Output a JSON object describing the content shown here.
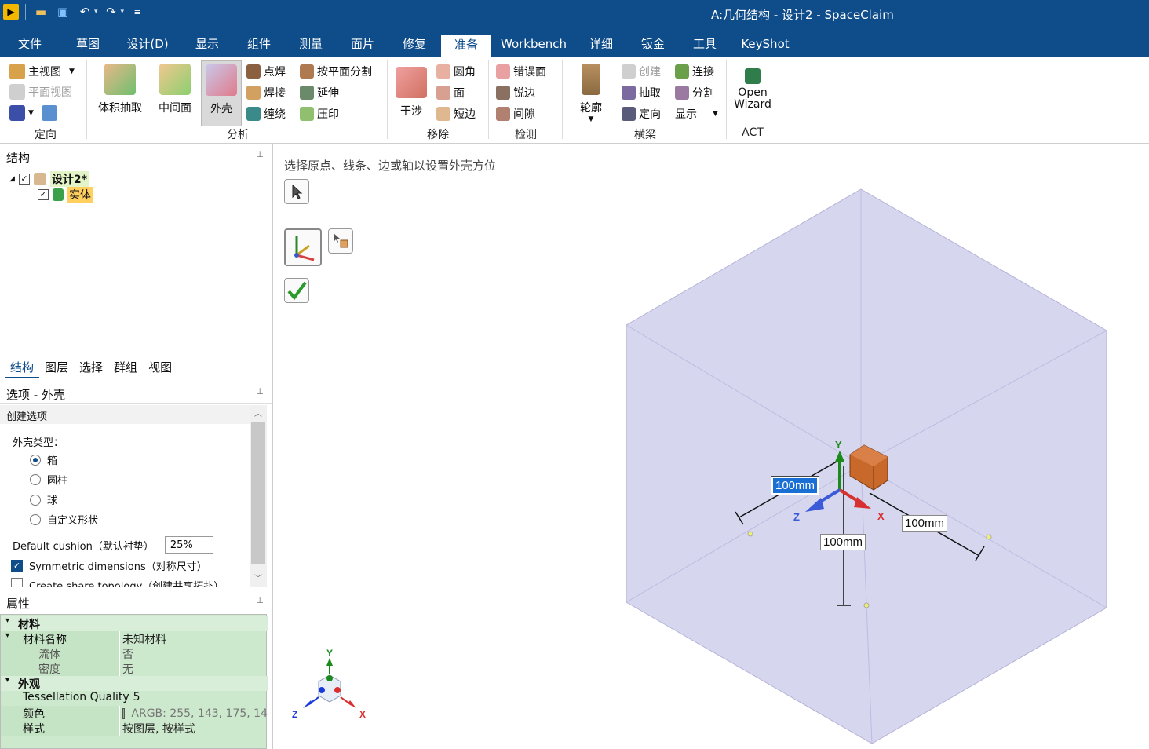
{
  "window": {
    "title": "A:几何结构 - 设计2 - SpaceClaim"
  },
  "menu": {
    "tabs": [
      "文件",
      "草图",
      "设计(D)",
      "显示",
      "组件",
      "测量",
      "面片",
      "修复",
      "准备",
      "Workbench",
      "详细",
      "钣金",
      "工具",
      "KeyShot"
    ],
    "active": "准备"
  },
  "ribbon": {
    "orient": {
      "home": "主视图",
      "plan": "平面视图",
      "label": "定向"
    },
    "analysis": {
      "volume_extract": "体积抽取",
      "mid_surface": "中间面",
      "enclosure": "外壳",
      "spot_weld": "点焊",
      "weld": "焊接",
      "wrap": "缠绕",
      "split_by_plane": "按平面分割",
      "extend": "延伸",
      "imprint": "压印",
      "label": "分析"
    },
    "remove": {
      "interference": "干涉",
      "round": "圆角",
      "face": "面",
      "short_edge": "短边",
      "label": "移除"
    },
    "detect": {
      "bad_face": "错误面",
      "sharp_edge": "锐边",
      "gap": "间隙",
      "label": "检测"
    },
    "beam": {
      "profile": "轮廓",
      "create": "创建",
      "extract": "抽取",
      "orient": "定向",
      "connect": "连接",
      "split": "分割",
      "display": "显示",
      "label": "横梁"
    },
    "act": {
      "open_wizard_1": "Open",
      "open_wizard_2": "Wizard",
      "label": "ACT"
    }
  },
  "structure": {
    "header": "结构",
    "root": "设计2*",
    "child": "实体",
    "tabs": [
      "结构",
      "图层",
      "选择",
      "群组",
      "视图"
    ]
  },
  "options": {
    "header": "选项 - 外壳",
    "section": "创建选项",
    "enclosure_type_label": "外壳类型：",
    "types": [
      "箱",
      "圆柱",
      "球",
      "自定义形状"
    ],
    "selected_type": "箱",
    "cushion_label": "Default cushion（默认衬垫）",
    "cushion_value": "25%",
    "symmetric_label": "Symmetric dimensions（对称尺寸）",
    "symmetric_checked": true,
    "share_topology_label": "Create share topology（创建共享拓扑）",
    "share_topology_checked": false
  },
  "properties": {
    "header": "属性",
    "material_cat": "材料",
    "material_name_key": "材料名称",
    "material_name_val": "未知材料",
    "fluid_key": "流体",
    "fluid_val": "否",
    "density_key": "密度",
    "density_val": "无",
    "appearance_cat": "外观",
    "tess_key": "Tessellation Quality",
    "tess_val": "5",
    "color_key": "颜色",
    "color_val": "ARGB: 255, 143, 175, 14",
    "color_swatch": "#8faf8e",
    "style_key": "样式",
    "style_val": "按图层, 按样式"
  },
  "viewport": {
    "hint": "选择原点、线条、边或轴以设置外壳方位",
    "dim_selected": "100mm",
    "dim_vertical": "100mm",
    "dim_right": "100mm",
    "triad": {
      "x": "X",
      "y": "Y",
      "z": "Z"
    },
    "compass": {
      "x": "X",
      "y": "Y",
      "z": "Z"
    }
  },
  "colors": {
    "titlebar": "#0f4c8a",
    "enclosure": "#c9c8ea",
    "part": "#c8682a",
    "selection": "#1a6fd4"
  }
}
